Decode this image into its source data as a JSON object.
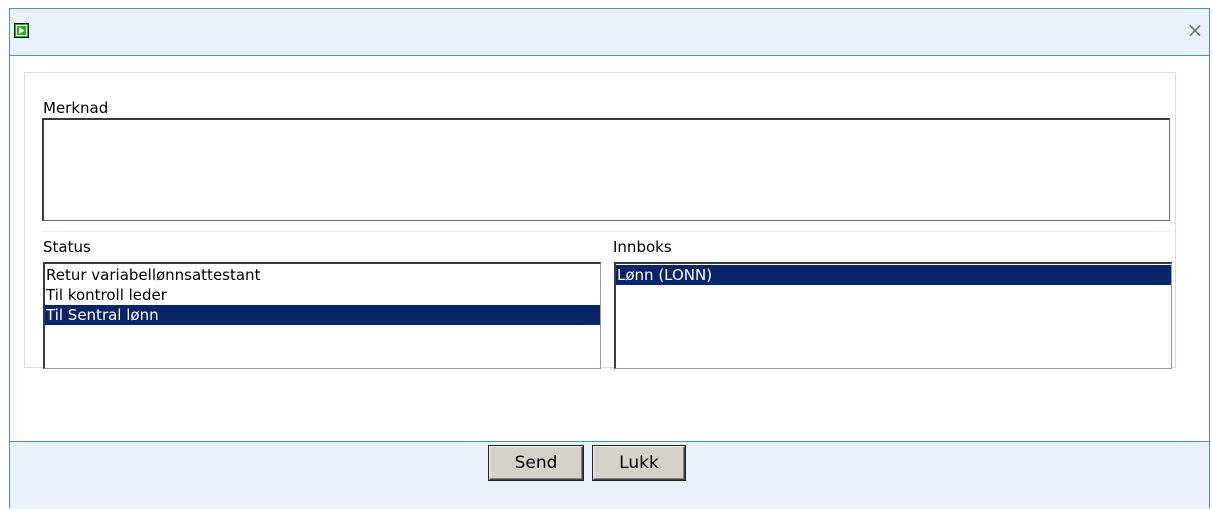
{
  "window": {
    "close_symbol": "×",
    "icon": "play-icon",
    "accent_color": "#4a90c2",
    "header_bg": "#e9f2fb",
    "selection_color": "#0a246a"
  },
  "form": {
    "merknad_label": "Merknad",
    "merknad_value": "",
    "status_label": "Status",
    "status_options": [
      {
        "label": "Retur variabellønnsattestant",
        "selected": false
      },
      {
        "label": "Til kontroll leder",
        "selected": false
      },
      {
        "label": "Til Sentral lønn",
        "selected": true
      }
    ],
    "innboks_label": "Innboks",
    "innboks_options": [
      {
        "label": "Lønn (LONN)",
        "selected": true
      }
    ]
  },
  "footer": {
    "send_label": "Send",
    "lukk_label": "Lukk"
  }
}
